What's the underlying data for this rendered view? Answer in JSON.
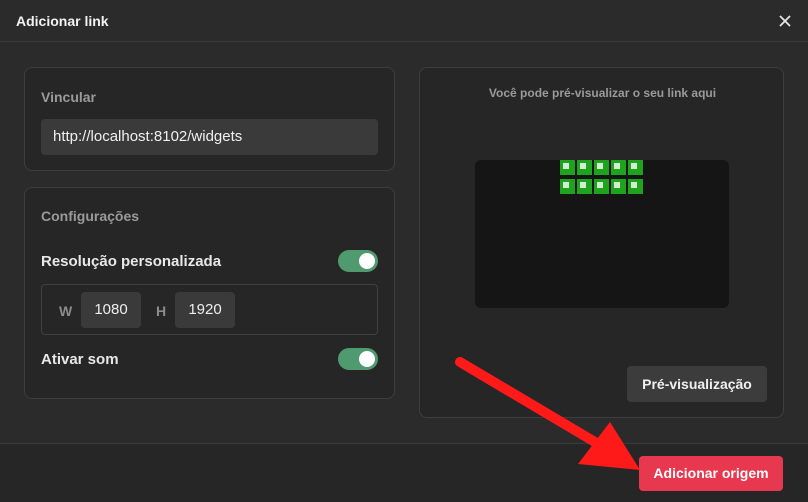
{
  "dialog": {
    "title": "Adicionar link"
  },
  "link": {
    "section_label": "Vincular",
    "url": "http://localhost:8102/widgets"
  },
  "settings": {
    "section_label": "Configurações",
    "custom_resolution": {
      "label": "Resolução personalizada",
      "enabled": true
    },
    "width": {
      "letter": "W",
      "value": "1080"
    },
    "height": {
      "letter": "H",
      "value": "1920"
    },
    "sound": {
      "label": "Ativar som",
      "enabled": true
    }
  },
  "preview": {
    "caption": "Você pode pré-visualizar o seu link aqui",
    "button_label": "Pré-visualização"
  },
  "footer": {
    "add_button_label": "Adicionar origem"
  },
  "colors": {
    "accent": "#e8384f",
    "toggle_on": "#4f9a6e",
    "annotation_arrow": "#ff1a1a"
  }
}
